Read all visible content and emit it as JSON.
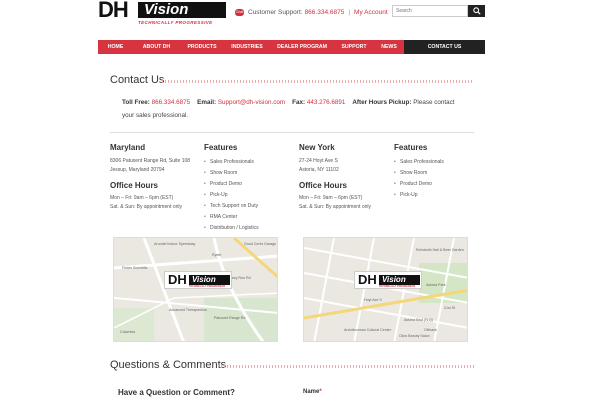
{
  "header": {
    "logo_primary": "DH",
    "logo_secondary": "Vision",
    "logo_tagline": "TECHNICALLY PROGRESSIVE",
    "support_label": "Customer Support:",
    "support_phone": "866.334.6875",
    "separator": "|",
    "account_link": "My Account",
    "search_placeholder": "Search",
    "icons": {
      "chat": "chat-bubble-icon",
      "search": "search-icon"
    },
    "chat_text": "Chat"
  },
  "nav": {
    "items": [
      "HOME",
      "ABOUT DH",
      "PRODUCTS",
      "INDUSTRIES",
      "DEALER PROGRAM",
      "SUPPORT",
      "NEWS",
      "CONTACT US"
    ],
    "active": "CONTACT US"
  },
  "contact": {
    "title": "Contact Us",
    "tollfree_label": "Toll Free:",
    "tollfree": "866.334.6875",
    "email_label": "Email:",
    "email": "Support@dh-vision.com",
    "fax_label": "Fax:",
    "fax": "443.276.6891",
    "afterhours_label": "After Hours Pickup:",
    "afterhours_text": "Please contact your sales professional."
  },
  "locations": [
    {
      "name": "Maryland",
      "address1": "8306 Patuxent Range Rd, Suite 108",
      "address2": "Jessup, Maryland 20794",
      "hours_title": "Office Hours",
      "hours1": "Mon – Fri: 9am – 6pm (EST)",
      "hours2": "Sat. & Sun: By appointment only",
      "features_title": "Features",
      "features": [
        "Sales Professionals",
        "Show Room",
        "Product Demo",
        "Pick-Up",
        "Tech Support on Duty",
        "RMA Center",
        "Distribution / Logistics"
      ]
    },
    {
      "name": "New York",
      "address1": "27-24 Hoyt Ave S",
      "address2": "Astoria, NY 11102",
      "hours_title": "Office Hours",
      "hours1": "Mon – Fri: 9am – 6pm (EST)",
      "hours2": "Sat. & Sun: By appointment only",
      "features_title": "Features",
      "features": [
        "Sales Professionals",
        "Show Room",
        "Product Demo",
        "Pick-Up"
      ]
    }
  ],
  "maps": [
    {
      "labels": [
        "Arundel Indoor Speedway",
        "Fisher Scientific",
        "Advanced Therapeutics",
        "Ryder",
        "Good Cents Garage",
        "Patuxent Range Rd",
        "Dorsey Run Rd",
        "Columbia"
      ]
    },
    {
      "labels": [
        "Rehoboth Hall & Beer Garden",
        "Astoria Park",
        "Astoria Blvd (N,Q)",
        "Citibank",
        "Citos Beauty Salon",
        "Archdiocesan Cultural Center",
        "21st St",
        "Hoyt Ave S"
      ]
    }
  ],
  "questions": {
    "title": "Questions & Comments",
    "subtitle": "Have a Question or Comment?",
    "name_label": "Name",
    "required_mark": "*"
  },
  "colors": {
    "accent": "#d7343f",
    "dark": "#222222"
  }
}
